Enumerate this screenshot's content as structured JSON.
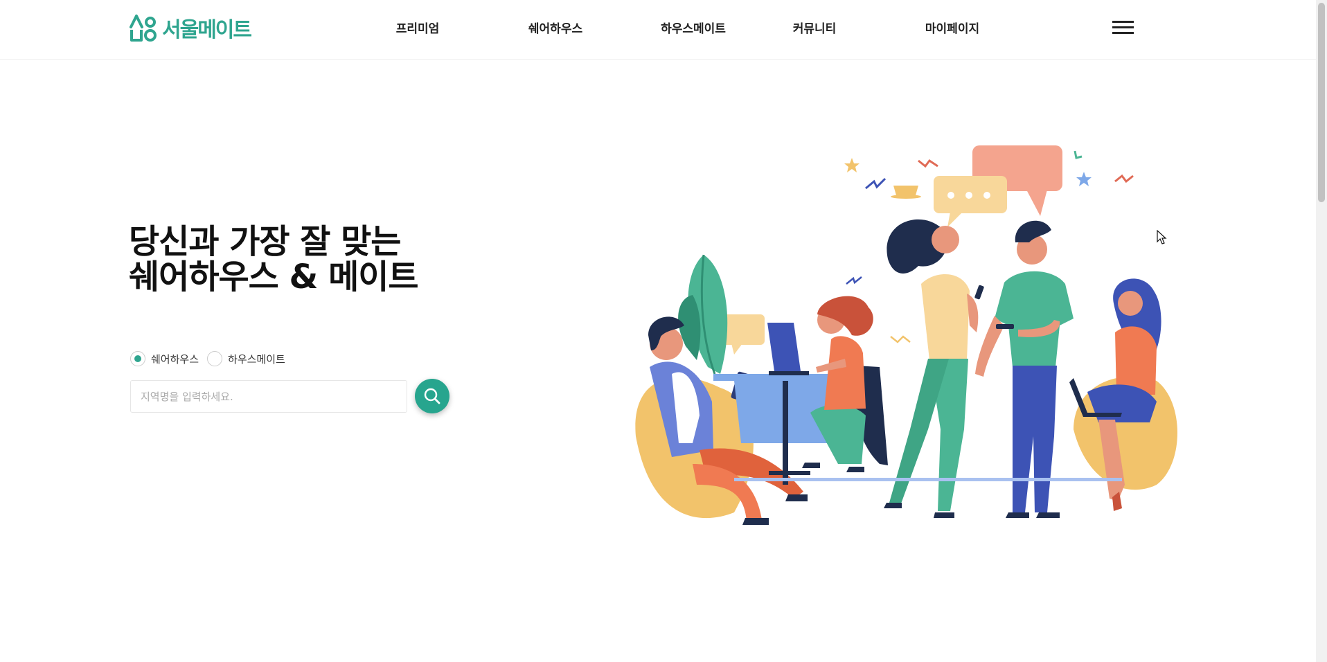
{
  "brand": {
    "name": "서울메이트",
    "color": "#2fa58f"
  },
  "nav": {
    "items": [
      {
        "label": "프리미엄",
        "name": "nav-premium"
      },
      {
        "label": "쉐어하우스",
        "name": "nav-sharehouse"
      },
      {
        "label": "하우스메이트",
        "name": "nav-housemate"
      },
      {
        "label": "커뮤니티",
        "name": "nav-community"
      },
      {
        "label": "마이페이지",
        "name": "nav-mypage"
      }
    ],
    "menu_icon": "hamburger-menu-icon"
  },
  "hero": {
    "title_line1": "당신과 가장 잘 맞는",
    "title_line2": "쉐어하우스 & 메이트"
  },
  "search": {
    "options": [
      {
        "label": "쉐어하우스",
        "checked": true
      },
      {
        "label": "하우스메이트",
        "checked": false
      }
    ],
    "placeholder": "지역명을 입력하세요.",
    "button_icon": "search-icon",
    "button_color": "#27a58e"
  }
}
